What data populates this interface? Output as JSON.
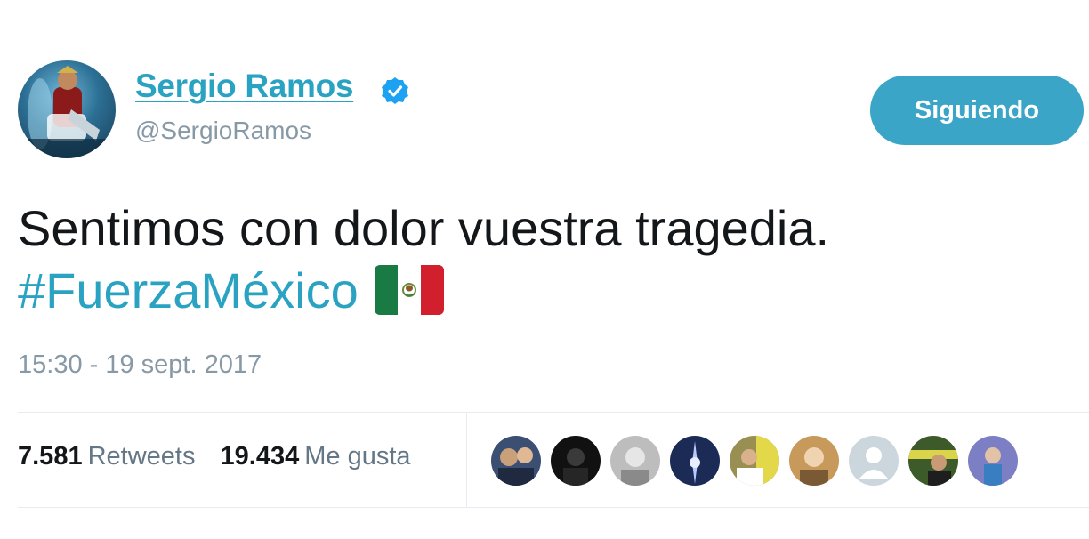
{
  "user": {
    "display_name": "Sergio Ramos",
    "handle": "@SergioRamos",
    "verified": true
  },
  "follow_button": {
    "label": "Siguiendo"
  },
  "tweet": {
    "text": "Sentimos con dolor vuestra tragedia.",
    "hashtag": "#FuerzaMéxico",
    "emoji": "mexico-flag",
    "timestamp": "15:30 - 19 sept. 2017"
  },
  "stats": {
    "retweets_count": "7.581",
    "retweets_label": "Retweets",
    "likes_count": "19.434",
    "likes_label": "Me gusta"
  },
  "likers_count_shown": 9,
  "colors": {
    "accent": "#2aa3c2",
    "button": "#3ba5c8",
    "muted": "#8899a6",
    "verified": "#1da1f2"
  }
}
